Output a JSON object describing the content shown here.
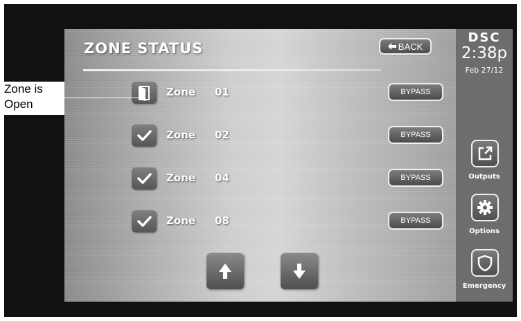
{
  "screen": {
    "title": "ZONE STATUS",
    "back_label": "BACK"
  },
  "annotation": {
    "callout_line1": "Zone is",
    "callout_line2": "Open"
  },
  "zones": [
    {
      "label": "Zone",
      "number": "01",
      "status": "open",
      "icon": "door-open-icon",
      "bypass_label": "BYPASS"
    },
    {
      "label": "Zone",
      "number": "02",
      "status": "ready",
      "icon": "checkmark-icon",
      "bypass_label": "BYPASS"
    },
    {
      "label": "Zone",
      "number": "04",
      "status": "ready",
      "icon": "checkmark-icon",
      "bypass_label": "BYPASS"
    },
    {
      "label": "Zone",
      "number": "08",
      "status": "ready",
      "icon": "checkmark-icon",
      "bypass_label": "BYPASS"
    }
  ],
  "nav": {
    "up_icon": "arrow-up-icon",
    "down_icon": "arrow-down-icon"
  },
  "sidebar": {
    "brand": "DSC",
    "time": "2:38p",
    "date": "Feb 27/12",
    "buttons": [
      {
        "label": "Outputs",
        "icon": "external-link-icon"
      },
      {
        "label": "Options",
        "icon": "gear-icon"
      },
      {
        "label": "Emergency",
        "icon": "shield-icon"
      }
    ]
  },
  "colors": {
    "bezel": "#111111",
    "sidebar": "#6d6d6d",
    "button_border": "#efefef",
    "text": "#ffffff"
  }
}
